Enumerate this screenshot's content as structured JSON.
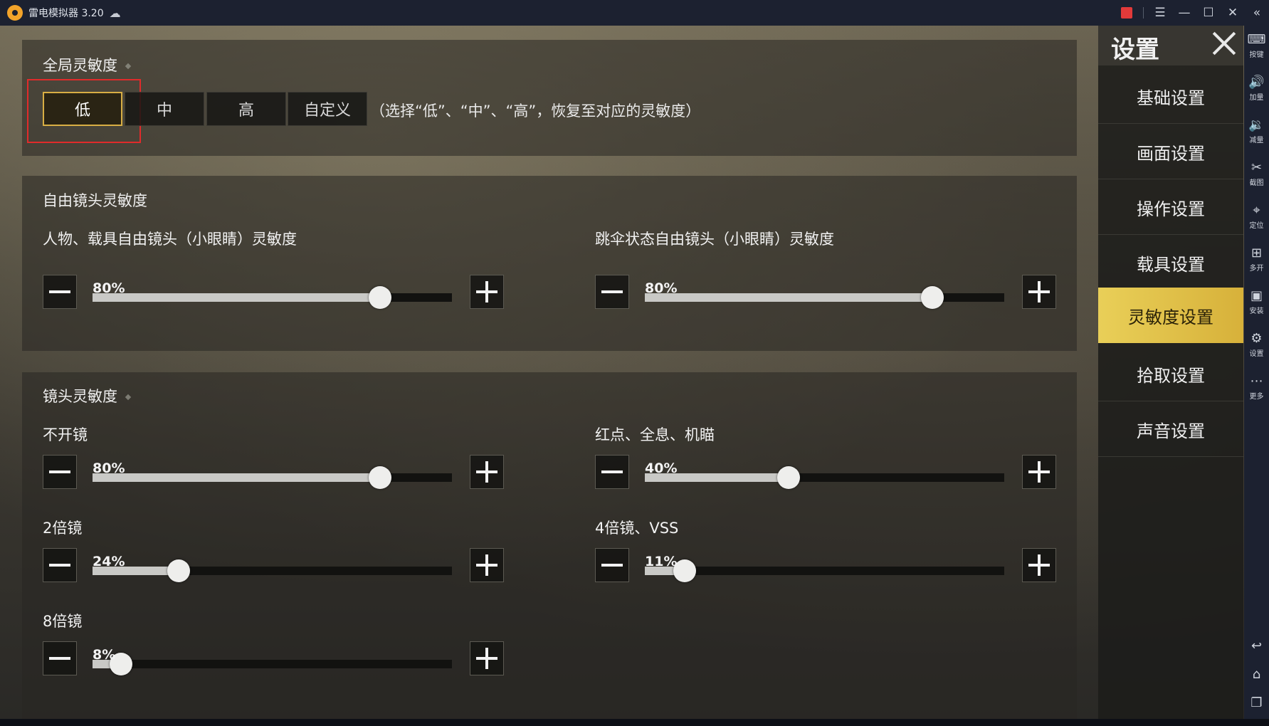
{
  "window": {
    "title": "雷电模拟器 3.20"
  },
  "sections": {
    "global": {
      "title": "全局灵敏度"
    },
    "free_look": {
      "title": "自由镜头灵敏度"
    },
    "camera": {
      "title": "镜头灵敏度"
    }
  },
  "presets": {
    "buttons": [
      "低",
      "中",
      "高",
      "自定义"
    ],
    "selected": "低",
    "note": "（选择“低”、“中”、“高”，恢复至对应的灵敏度）"
  },
  "sliders": [
    {
      "label": "人物、载具自由镜头（小眼睛）灵敏度",
      "percent": "80%",
      "value": 0.8
    },
    {
      "label": "跳伞状态自由镜头（小眼睛）灵敏度",
      "percent": "80%",
      "value": 0.8
    },
    {
      "label": "不开镜",
      "percent": "80%",
      "value": 0.8
    },
    {
      "label": "红点、全息、机瞄",
      "percent": "40%",
      "value": 0.4
    },
    {
      "label": "2倍镜",
      "percent": "24%",
      "value": 0.24
    },
    {
      "label": "4倍镜、VSS",
      "percent": "11%",
      "value": 0.11
    },
    {
      "label": "8倍镜",
      "percent": "8%",
      "value": 0.08
    }
  ],
  "menu": {
    "title": "设置",
    "items": [
      "基础设置",
      "画面设置",
      "操作设置",
      "载具设置",
      "灵敏度设置",
      "拾取设置",
      "声音设置"
    ],
    "active": "灵敏度设置"
  },
  "sidebar": {
    "items": [
      {
        "icon": "keyboard-icon",
        "label": "按键"
      },
      {
        "icon": "volume-up-icon",
        "label": "加量"
      },
      {
        "icon": "volume-down-icon",
        "label": "减量"
      },
      {
        "icon": "scissors-icon",
        "label": "截图"
      },
      {
        "icon": "location-pin-icon",
        "label": "定位"
      },
      {
        "icon": "multi-instance-icon",
        "label": "多开"
      },
      {
        "icon": "apk-install-icon",
        "label": "安装"
      },
      {
        "icon": "gear-icon",
        "label": "设置"
      },
      {
        "icon": "more-icon",
        "label": "更多"
      }
    ]
  },
  "colors": {
    "accent": "#d8ae44",
    "highlight": "#e02b2b",
    "menu_active": "#e9cf58"
  }
}
